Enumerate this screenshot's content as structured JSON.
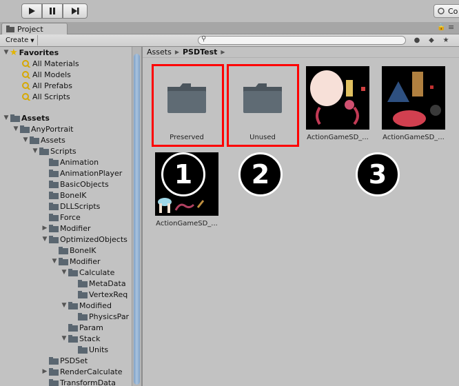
{
  "toolbar": {
    "play_icon": "play-icon",
    "pause_icon": "pause-icon",
    "step_icon": "step-icon",
    "collab_label": "Co"
  },
  "project_tab": {
    "label": "Project",
    "icon": "folder-icon"
  },
  "project_toolbar": {
    "create_label": "Create",
    "search_value": "",
    "search_icon": "search-icon"
  },
  "tree": {
    "favorites": {
      "label": "Favorites",
      "items": [
        "All Materials",
        "All Models",
        "All Prefabs",
        "All Scripts"
      ]
    },
    "assets": {
      "label": "Assets",
      "rows": [
        {
          "label": "AnyPortrait",
          "depth": 1,
          "arrow": "down"
        },
        {
          "label": "Assets",
          "depth": 2,
          "arrow": "down"
        },
        {
          "label": "Scripts",
          "depth": 3,
          "arrow": "down"
        },
        {
          "label": "Animation",
          "depth": 4,
          "arrow": ""
        },
        {
          "label": "AnimationPlayer",
          "depth": 4,
          "arrow": ""
        },
        {
          "label": "BasicObjects",
          "depth": 4,
          "arrow": ""
        },
        {
          "label": "BoneIK",
          "depth": 4,
          "arrow": ""
        },
        {
          "label": "DLLScripts",
          "depth": 4,
          "arrow": ""
        },
        {
          "label": "Force",
          "depth": 4,
          "arrow": ""
        },
        {
          "label": "Modifier",
          "depth": 4,
          "arrow": "right"
        },
        {
          "label": "OptimizedObjects",
          "depth": 4,
          "arrow": "down"
        },
        {
          "label": "BoneIK",
          "depth": 5,
          "arrow": ""
        },
        {
          "label": "Modifier",
          "depth": 5,
          "arrow": "down"
        },
        {
          "label": "Calculate",
          "depth": 6,
          "arrow": "down"
        },
        {
          "label": "MetaData",
          "depth": 7,
          "arrow": ""
        },
        {
          "label": "VertexReq",
          "depth": 7,
          "arrow": ""
        },
        {
          "label": "Modified",
          "depth": 6,
          "arrow": "down"
        },
        {
          "label": "PhysicsPar",
          "depth": 7,
          "arrow": ""
        },
        {
          "label": "Param",
          "depth": 6,
          "arrow": ""
        },
        {
          "label": "Stack",
          "depth": 6,
          "arrow": "down"
        },
        {
          "label": "Units",
          "depth": 7,
          "arrow": ""
        },
        {
          "label": "PSDSet",
          "depth": 4,
          "arrow": ""
        },
        {
          "label": "RenderCalculate",
          "depth": 4,
          "arrow": "right"
        },
        {
          "label": "TransformData",
          "depth": 4,
          "arrow": ""
        }
      ]
    }
  },
  "breadcrumb": {
    "root": "Assets",
    "current": "PSDTest"
  },
  "grid": [
    {
      "label": "Preserved",
      "kind": "folder"
    },
    {
      "label": "Unused",
      "kind": "folder"
    },
    {
      "label": "ActionGameSD_...",
      "kind": "sprite"
    },
    {
      "label": "ActionGameSD_...",
      "kind": "sprite"
    },
    {
      "label": "ActionGameSD_...",
      "kind": "sprite"
    }
  ],
  "badges": [
    "1",
    "2",
    "3"
  ],
  "colors": {
    "highlight": "#ff0000",
    "badge_bg": "#000000",
    "folder": "#5c6870"
  }
}
